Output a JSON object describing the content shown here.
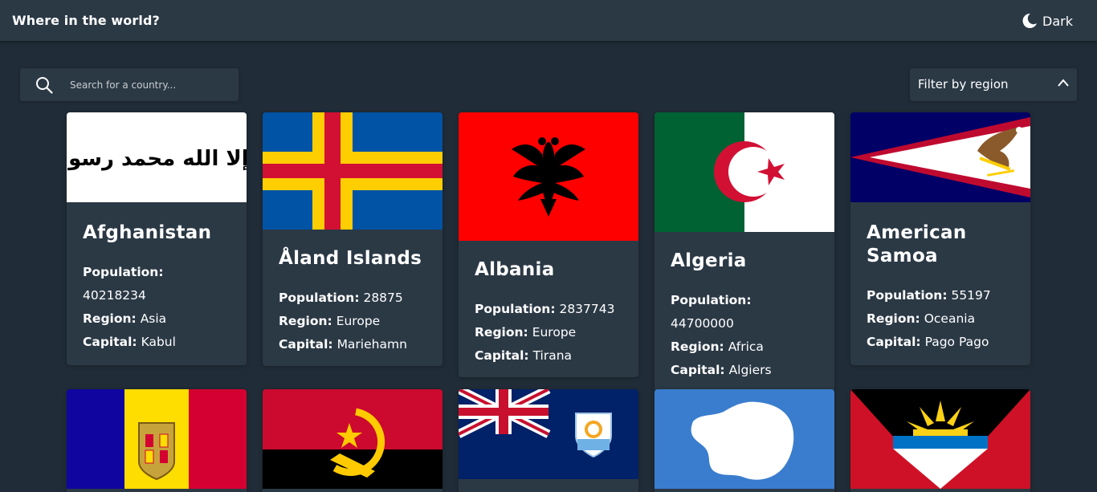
{
  "header": {
    "title": "Where in the world?",
    "theme_label": "Dark"
  },
  "search": {
    "placeholder": "Search for a country..."
  },
  "filter": {
    "label": "Filter by region"
  },
  "stat_labels": {
    "population": "Population:",
    "region": "Region:",
    "capital": "Capital:"
  },
  "countries": [
    {
      "name": "Afghanistan",
      "population": "40218234",
      "region": "Asia",
      "capital": "Kabul",
      "flag_script": "لا إله إلا الله محمد رسول الله"
    },
    {
      "name": "Åland Islands",
      "population": "28875",
      "region": "Europe",
      "capital": "Mariehamn"
    },
    {
      "name": "Albania",
      "population": "2837743",
      "region": "Europe",
      "capital": "Tirana"
    },
    {
      "name": "Algeria",
      "population": "44700000",
      "region": "Africa",
      "capital": "Algiers"
    },
    {
      "name": "American Samoa",
      "population": "55197",
      "region": "Oceania",
      "capital": "Pago Pago"
    }
  ],
  "second_row_flags": [
    "Andorra",
    "Angola",
    "Anguilla",
    "Antarctica",
    "Antigua and Barbuda"
  ],
  "colors": {
    "background": "#202c37",
    "elements": "#2b3945",
    "text": "#ffffff"
  }
}
